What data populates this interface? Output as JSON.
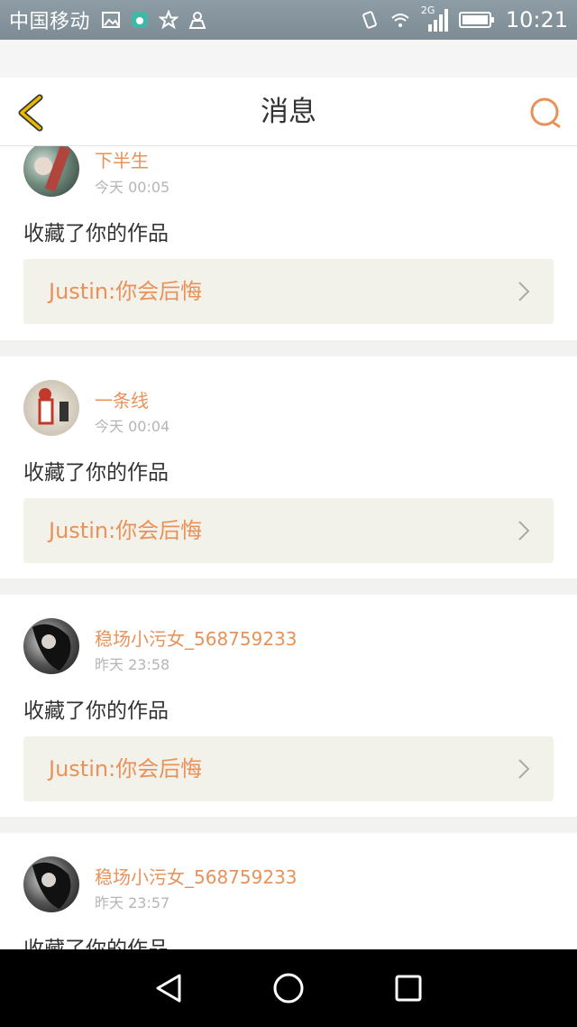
{
  "status_bar": {
    "carrier": "中国移动",
    "network": "2G",
    "time": "10:21"
  },
  "header": {
    "title": "消息",
    "back_icon": "chevron-left-icon",
    "search_icon": "search-icon"
  },
  "colors": {
    "accent": "#e8925a",
    "back_arrow": "#e6b800",
    "work_bg": "#f3f2ea"
  },
  "messages": [
    {
      "user": "下半生",
      "time": "今天 00:05",
      "action": "收藏了你的作品",
      "work": "Justin:你会后悔"
    },
    {
      "user": "一条线",
      "time": "今天 00:04",
      "action": "收藏了你的作品",
      "work": "Justin:你会后悔"
    },
    {
      "user": "稳场小污女_568759233",
      "time": "昨天 23:58",
      "action": "收藏了你的作品",
      "work": "Justin:你会后悔"
    },
    {
      "user": "稳场小污女_568759233",
      "time": "昨天 23:57",
      "action": "收藏了你的作品"
    }
  ]
}
